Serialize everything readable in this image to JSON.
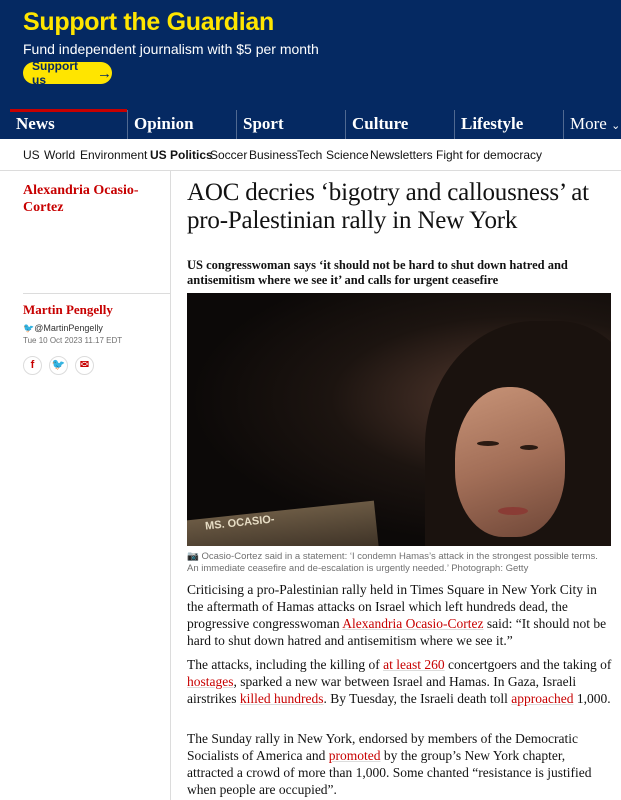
{
  "support": {
    "title": "Support the Guardian",
    "subtitle": "Fund independent journalism with $5 per month",
    "button": "Support us",
    "button_icon": "arrow-right-icon"
  },
  "pillars": [
    {
      "label": "News",
      "color": "#c70000"
    },
    {
      "label": "Opinion",
      "color": "#e05e00"
    },
    {
      "label": "Sport",
      "color": "#0084c6"
    },
    {
      "label": "Culture",
      "color": "#a1845c"
    },
    {
      "label": "Lifestyle",
      "color": "#bb3b80"
    },
    {
      "label": "More",
      "color": "#ffffff"
    }
  ],
  "subnav": [
    "US",
    "World",
    "Environment",
    "US Politics",
    "Soccer",
    "Business",
    "Tech",
    "Science",
    "Newsletters",
    "Fight for democracy"
  ],
  "subnav_active": "US Politics",
  "article": {
    "tag": "Alexandria Ocasio-Cortez",
    "author": "Martin Pengelly",
    "twitter": "@MartinPengelly",
    "date": "Tue 10 Oct 2023 11.17 EDT",
    "share_icons": [
      "facebook-icon",
      "twitter-icon",
      "email-icon"
    ],
    "headline": "AOC decries ‘bigotry and callousness’ at pro-Palestinian rally in New York",
    "standfirst": "US congresswoman says ‘it should not be hard to shut down hatred and antisemitism where we see it’ and calls for urgent ceasefire",
    "image_plate_text": "MS. OCASIO-",
    "caption": "Ocasio-Cortez said in a statement: ‘I condemn Hamas’s attack in the strongest possible terms. An immediate ceasefire and de-escalation is urgently needed.’ Photograph: Getty",
    "p1_a": "Criticising a pro-Palestinian rally held in Times Square in New York City in the aftermath of Hamas attacks on Israel which left hundreds dead, the progressive congresswoman ",
    "p1_link": "Alexandria Ocasio-Cortez",
    "p1_b": " said: “It should not be hard to shut down hatred and antisemitism where we see it.”",
    "p2_a": "The attacks, including the killing of ",
    "p2_link1": "at least 260",
    "p2_b": " concertgoers and the taking of ",
    "p2_link2": "hostages",
    "p2_c": ", sparked a new war between Israel and Hamas. In Gaza, Israeli airstrikes ",
    "p2_link3": "killed hundreds",
    "p2_d": ". By Tuesday, the Israeli death toll ",
    "p2_link4": "approached",
    "p2_e": " 1,000.",
    "p3_a": "The Sunday rally in New York, endorsed by members of the Democratic Socialists of America and ",
    "p3_link": "promoted",
    "p3_b": " by the group’s New York chapter, attracted a crowd of more than 1,000. Some chanted “resistance is justified when people are occupied”."
  }
}
